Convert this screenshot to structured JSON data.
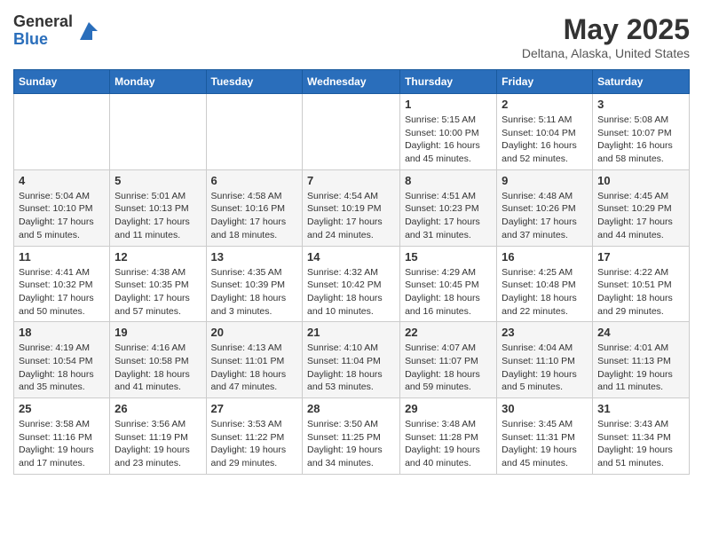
{
  "header": {
    "logo_general": "General",
    "logo_blue": "Blue",
    "month_title": "May 2025",
    "location": "Deltana, Alaska, United States"
  },
  "days_of_week": [
    "Sunday",
    "Monday",
    "Tuesday",
    "Wednesday",
    "Thursday",
    "Friday",
    "Saturday"
  ],
  "weeks": [
    [
      {
        "day": "",
        "info": ""
      },
      {
        "day": "",
        "info": ""
      },
      {
        "day": "",
        "info": ""
      },
      {
        "day": "",
        "info": ""
      },
      {
        "day": "1",
        "info": "Sunrise: 5:15 AM\nSunset: 10:00 PM\nDaylight: 16 hours\nand 45 minutes."
      },
      {
        "day": "2",
        "info": "Sunrise: 5:11 AM\nSunset: 10:04 PM\nDaylight: 16 hours\nand 52 minutes."
      },
      {
        "day": "3",
        "info": "Sunrise: 5:08 AM\nSunset: 10:07 PM\nDaylight: 16 hours\nand 58 minutes."
      }
    ],
    [
      {
        "day": "4",
        "info": "Sunrise: 5:04 AM\nSunset: 10:10 PM\nDaylight: 17 hours\nand 5 minutes."
      },
      {
        "day": "5",
        "info": "Sunrise: 5:01 AM\nSunset: 10:13 PM\nDaylight: 17 hours\nand 11 minutes."
      },
      {
        "day": "6",
        "info": "Sunrise: 4:58 AM\nSunset: 10:16 PM\nDaylight: 17 hours\nand 18 minutes."
      },
      {
        "day": "7",
        "info": "Sunrise: 4:54 AM\nSunset: 10:19 PM\nDaylight: 17 hours\nand 24 minutes."
      },
      {
        "day": "8",
        "info": "Sunrise: 4:51 AM\nSunset: 10:23 PM\nDaylight: 17 hours\nand 31 minutes."
      },
      {
        "day": "9",
        "info": "Sunrise: 4:48 AM\nSunset: 10:26 PM\nDaylight: 17 hours\nand 37 minutes."
      },
      {
        "day": "10",
        "info": "Sunrise: 4:45 AM\nSunset: 10:29 PM\nDaylight: 17 hours\nand 44 minutes."
      }
    ],
    [
      {
        "day": "11",
        "info": "Sunrise: 4:41 AM\nSunset: 10:32 PM\nDaylight: 17 hours\nand 50 minutes."
      },
      {
        "day": "12",
        "info": "Sunrise: 4:38 AM\nSunset: 10:35 PM\nDaylight: 17 hours\nand 57 minutes."
      },
      {
        "day": "13",
        "info": "Sunrise: 4:35 AM\nSunset: 10:39 PM\nDaylight: 18 hours\nand 3 minutes."
      },
      {
        "day": "14",
        "info": "Sunrise: 4:32 AM\nSunset: 10:42 PM\nDaylight: 18 hours\nand 10 minutes."
      },
      {
        "day": "15",
        "info": "Sunrise: 4:29 AM\nSunset: 10:45 PM\nDaylight: 18 hours\nand 16 minutes."
      },
      {
        "day": "16",
        "info": "Sunrise: 4:25 AM\nSunset: 10:48 PM\nDaylight: 18 hours\nand 22 minutes."
      },
      {
        "day": "17",
        "info": "Sunrise: 4:22 AM\nSunset: 10:51 PM\nDaylight: 18 hours\nand 29 minutes."
      }
    ],
    [
      {
        "day": "18",
        "info": "Sunrise: 4:19 AM\nSunset: 10:54 PM\nDaylight: 18 hours\nand 35 minutes."
      },
      {
        "day": "19",
        "info": "Sunrise: 4:16 AM\nSunset: 10:58 PM\nDaylight: 18 hours\nand 41 minutes."
      },
      {
        "day": "20",
        "info": "Sunrise: 4:13 AM\nSunset: 11:01 PM\nDaylight: 18 hours\nand 47 minutes."
      },
      {
        "day": "21",
        "info": "Sunrise: 4:10 AM\nSunset: 11:04 PM\nDaylight: 18 hours\nand 53 minutes."
      },
      {
        "day": "22",
        "info": "Sunrise: 4:07 AM\nSunset: 11:07 PM\nDaylight: 18 hours\nand 59 minutes."
      },
      {
        "day": "23",
        "info": "Sunrise: 4:04 AM\nSunset: 11:10 PM\nDaylight: 19 hours\nand 5 minutes."
      },
      {
        "day": "24",
        "info": "Sunrise: 4:01 AM\nSunset: 11:13 PM\nDaylight: 19 hours\nand 11 minutes."
      }
    ],
    [
      {
        "day": "25",
        "info": "Sunrise: 3:58 AM\nSunset: 11:16 PM\nDaylight: 19 hours\nand 17 minutes."
      },
      {
        "day": "26",
        "info": "Sunrise: 3:56 AM\nSunset: 11:19 PM\nDaylight: 19 hours\nand 23 minutes."
      },
      {
        "day": "27",
        "info": "Sunrise: 3:53 AM\nSunset: 11:22 PM\nDaylight: 19 hours\nand 29 minutes."
      },
      {
        "day": "28",
        "info": "Sunrise: 3:50 AM\nSunset: 11:25 PM\nDaylight: 19 hours\nand 34 minutes."
      },
      {
        "day": "29",
        "info": "Sunrise: 3:48 AM\nSunset: 11:28 PM\nDaylight: 19 hours\nand 40 minutes."
      },
      {
        "day": "30",
        "info": "Sunrise: 3:45 AM\nSunset: 11:31 PM\nDaylight: 19 hours\nand 45 minutes."
      },
      {
        "day": "31",
        "info": "Sunrise: 3:43 AM\nSunset: 11:34 PM\nDaylight: 19 hours\nand 51 minutes."
      }
    ]
  ]
}
